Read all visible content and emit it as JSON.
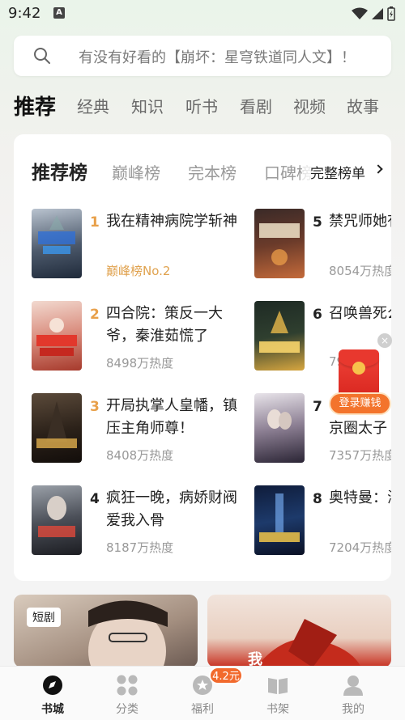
{
  "status_bar": {
    "time": "9:42",
    "app_icon": "A"
  },
  "search": {
    "placeholder": "有没有好看的【崩坏：星穹铁道同人文】！"
  },
  "top_tabs": [
    "推荐",
    "经典",
    "知识",
    "听书",
    "看剧",
    "视频",
    "故事"
  ],
  "ranking": {
    "tabs": [
      "推荐榜",
      "巅峰榜",
      "完本榜",
      "口碑榜"
    ],
    "full_list_label": "完整榜单",
    "books": [
      {
        "rank": "1",
        "title": "我在精神病院学斩神",
        "meta": "巅峰榜No.2"
      },
      {
        "rank": "2",
        "title": "四合院：策反一大爷，秦淮茹慌了",
        "meta": "8498万热度"
      },
      {
        "rank": "3",
        "title": "开局执掌人皇幡，镇压主角师尊！",
        "meta": "8408万热度"
      },
      {
        "rank": "4",
        "title": "疯狂一晚，病娇财阀爱我入骨",
        "meta": "8187万热度"
      },
      {
        "rank": "5",
        "title": "禁咒师她有不死之",
        "meta": "8054万热度"
      },
      {
        "rank": "6",
        "title": "召唤兽死么全是传",
        "meta": "79"
      },
      {
        "rank": "7",
        "title": "京圈太子",
        "meta": "7357万热度"
      },
      {
        "rank": "8",
        "title": "奥特曼：海帕杰顿",
        "meta": "7204万热度"
      }
    ]
  },
  "floating": {
    "login_label": "登录赚钱"
  },
  "banners": {
    "left_tag": "短剧",
    "right_text": "我"
  },
  "bottom_nav": {
    "items": [
      "书城",
      "分类",
      "福利",
      "书架",
      "我的"
    ],
    "welfare_badge": "4.2元"
  },
  "colors": {
    "accent_orange": "#f26a2d",
    "rank_gold": "#e8a04a",
    "red_packet": "#e8382e"
  }
}
